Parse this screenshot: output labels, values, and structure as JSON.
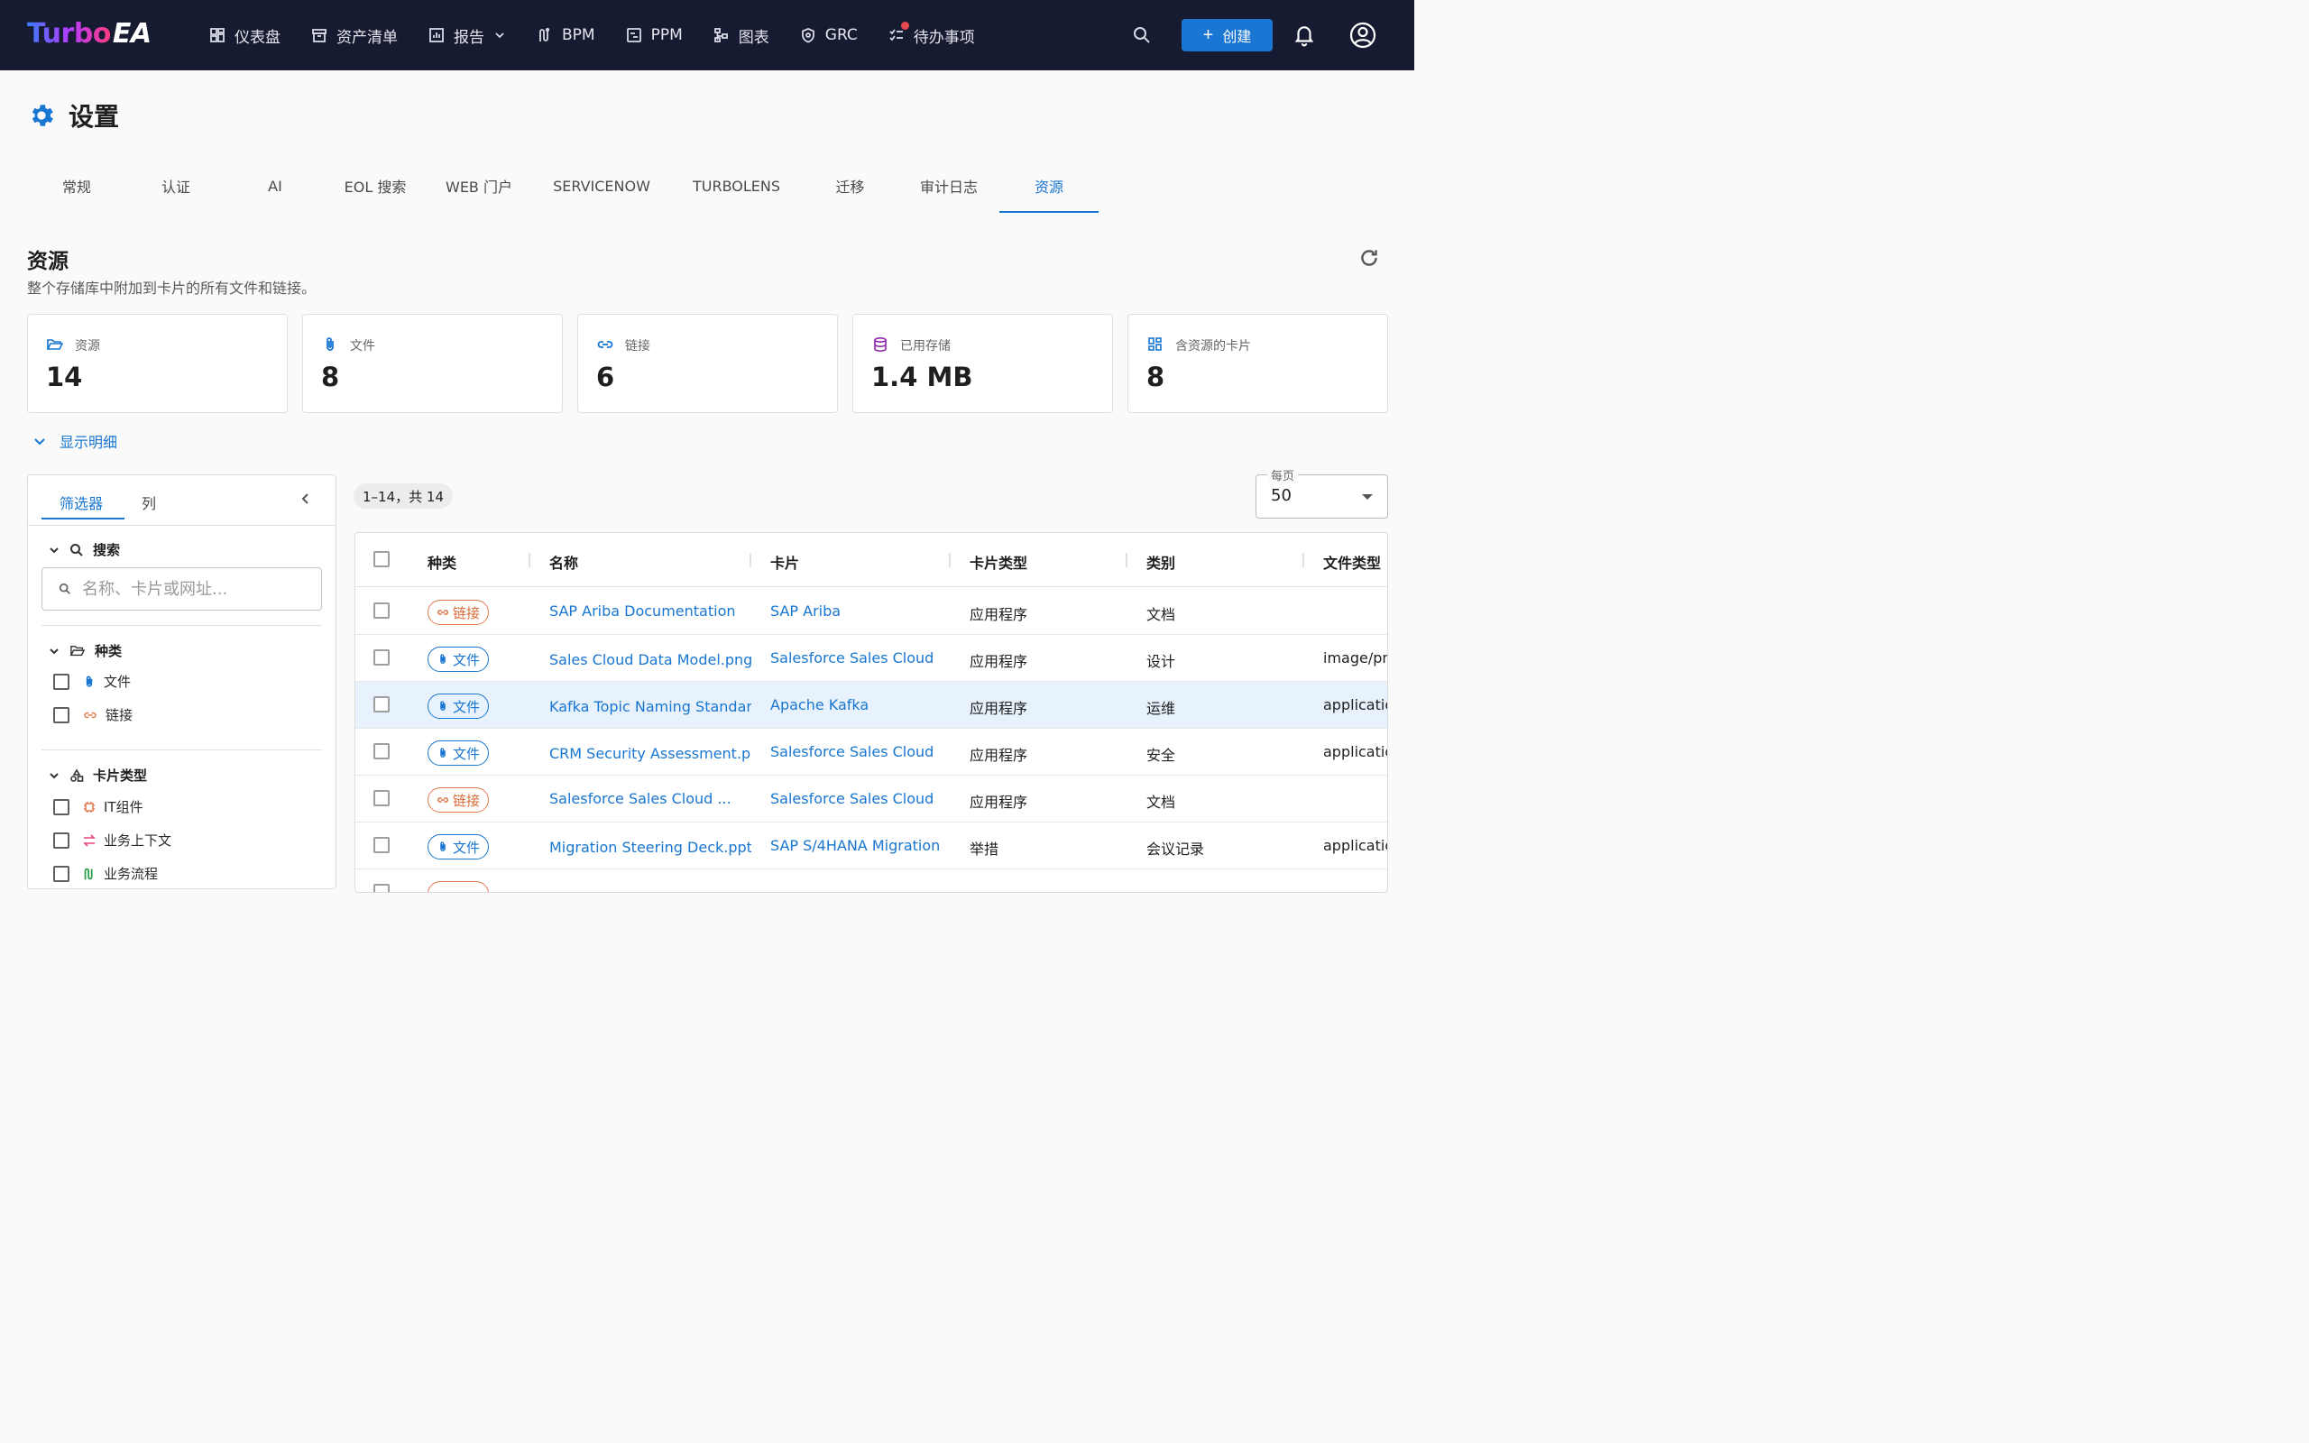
{
  "app": {
    "logo_turbo": "Turbo",
    "logo_ea": "EA"
  },
  "nav": {
    "items": [
      {
        "label": "仪表盘",
        "icon": "dashboard-icon"
      },
      {
        "label": "资产清单",
        "icon": "inventory-icon"
      },
      {
        "label": "报告",
        "icon": "report-icon"
      },
      {
        "label": "BPM",
        "icon": "bpm-icon"
      },
      {
        "label": "PPM",
        "icon": "ppm-icon"
      },
      {
        "label": "图表",
        "icon": "diagram-icon"
      },
      {
        "label": "GRC",
        "icon": "grc-icon"
      },
      {
        "label": "待办事项",
        "icon": "todo-icon"
      }
    ],
    "create_label": "创建"
  },
  "page": {
    "title": "设置"
  },
  "tabs": [
    "常规",
    "认证",
    "AI",
    "EOL 搜索",
    "WEB 门户",
    "SERVICENOW",
    "TURBOLENS",
    "迁移",
    "审计日志",
    "资源"
  ],
  "section": {
    "title": "资源",
    "description": "整个存储库中附加到卡片的所有文件和链接。",
    "details_toggle": "显示明细"
  },
  "stats": [
    {
      "label": "资源",
      "value": "14"
    },
    {
      "label": "文件",
      "value": "8"
    },
    {
      "label": "链接",
      "value": "6"
    },
    {
      "label": "已用存储",
      "value": "1.4 MB"
    },
    {
      "label": "含资源的卡片",
      "value": "8"
    }
  ],
  "filters": {
    "tab_filters": "筛选器",
    "tab_columns": "列",
    "search_heading": "搜索",
    "search_placeholder": "名称、卡片或网址...",
    "kind_heading": "种类",
    "kind_options": [
      "文件",
      "链接"
    ],
    "cardtype_heading": "卡片类型",
    "cardtype_options": [
      "IT组件",
      "业务上下文",
      "业务流程"
    ]
  },
  "table": {
    "count": "1–14，共 14",
    "per_page_label": "每页",
    "per_page_value": "50",
    "headers": [
      "种类",
      "名称",
      "卡片",
      "卡片类型",
      "类别",
      "文件类型"
    ],
    "rows": [
      {
        "kind": "链接",
        "name": "SAP Ariba Documentation",
        "card": "SAP Ariba",
        "card_type": "应用程序",
        "category": "文档",
        "file_type": ""
      },
      {
        "kind": "文件",
        "name": "Sales Cloud Data Model.png",
        "card": "Salesforce Sales Cloud",
        "card_type": "应用程序",
        "category": "设计",
        "file_type": "image/png"
      },
      {
        "kind": "文件",
        "name": "Kafka Topic Naming Standards",
        "card": "Apache Kafka",
        "card_type": "应用程序",
        "category": "运维",
        "file_type": "application"
      },
      {
        "kind": "文件",
        "name": "CRM Security Assessment.pdf",
        "card": "Salesforce Sales Cloud",
        "card_type": "应用程序",
        "category": "安全",
        "file_type": "application"
      },
      {
        "kind": "链接",
        "name": "Salesforce Sales Cloud ...",
        "card": "Salesforce Sales Cloud",
        "card_type": "应用程序",
        "category": "文档",
        "file_type": ""
      },
      {
        "kind": "文件",
        "name": "Migration Steering Deck.pptx",
        "card": "SAP S/4HANA Migration",
        "card_type": "举措",
        "category": "会议记录",
        "file_type": "application"
      }
    ]
  },
  "colors": {
    "topbar": "#171b31",
    "accent": "#1976d2",
    "link_chip": "#d96a3a"
  }
}
